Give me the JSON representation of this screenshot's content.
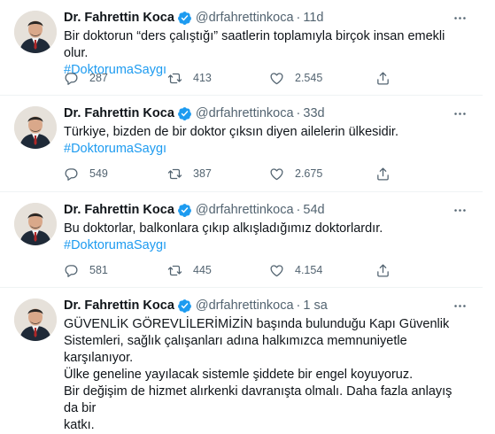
{
  "colors": {
    "accent": "#1d9bf0",
    "text": "#0f1419",
    "muted": "#536471",
    "divider": "#eff3f4"
  },
  "icons": [
    "verified-badge-icon",
    "more-icon",
    "reply-icon",
    "retweet-icon",
    "like-icon",
    "share-icon"
  ],
  "tweets": [
    {
      "name": "Dr. Fahrettin Koca",
      "handle": "@drfahrettinkoca",
      "dot": "·",
      "time": "11d",
      "text": "Bir doktorun “ders çalıştığı” saatlerin toplamıyla birçok insan emekli olur.",
      "hashtag": "#DoktorumaSaygı",
      "replies": "287",
      "retweets": "413",
      "likes": "2.545"
    },
    {
      "name": "Dr. Fahrettin Koca",
      "handle": "@drfahrettinkoca",
      "dot": "·",
      "time": "33d",
      "text": "Türkiye, bizden de bir doktor çıksın diyen ailelerin ülkesidir.",
      "hashtag": "#DoktorumaSaygı",
      "replies": "549",
      "retweets": "387",
      "likes": "2.675"
    },
    {
      "name": "Dr. Fahrettin Koca",
      "handle": "@drfahrettinkoca",
      "dot": "·",
      "time": "54d",
      "text": "Bu doktorlar, balkonlara çıkıp alkışladığımız doktorlardır.",
      "hashtag": "#DoktorumaSaygı",
      "replies": "581",
      "retweets": "445",
      "likes": "4.154"
    },
    {
      "name": "Dr. Fahrettin Koca",
      "handle": "@drfahrettinkoca",
      "dot": "·",
      "time": "1 sa",
      "text": "GÜVENLİK GÖREVLİLERİMİZİN başında bulunduğu Kapı Güvenlik\nSistemleri, sağlık çalışanları adına halkımızca memnuniyetle karşılanıyor.\nÜlke geneline yayılacak sistemle şiddete bir engel koyuyoruz.\nBir değişim de hizmet alırkenki davranışta olmalı. Daha fazla anlayış da bir\nkatkı."
    }
  ]
}
